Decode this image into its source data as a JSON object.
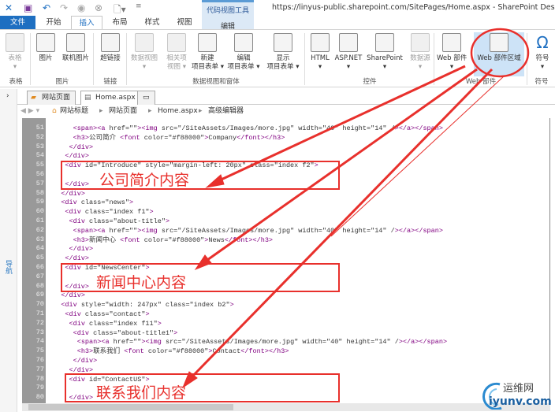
{
  "window": {
    "title": "https://linyus-public.sharepoint.com/SitePages/Home.aspx - SharePoint Designer",
    "context_tool": "代码视图工具",
    "context_tab": "编辑"
  },
  "tabs": [
    "文件",
    "开始",
    "插入",
    "布局",
    "样式",
    "视图"
  ],
  "ribbon": {
    "buttons": [
      {
        "label": "表格",
        "sub": "▾",
        "disabled": true
      },
      {
        "label": "图片"
      },
      {
        "label": "联机图片"
      },
      {
        "label": "超链接"
      },
      {
        "label": "数据视图",
        "sub": "▾",
        "disabled": true
      },
      {
        "label": "相关项",
        "sub": "视图 ▾",
        "disabled": true
      },
      {
        "label": "新建",
        "sub": "项目表单 ▾"
      },
      {
        "label": "编辑",
        "sub": "项目表单 ▾"
      },
      {
        "label": "显示",
        "sub": "项目表单 ▾"
      },
      {
        "label": "HTML",
        "sub": "▾"
      },
      {
        "label": "ASP.NET",
        "sub": "▾"
      },
      {
        "label": "SharePoint",
        "sub": "▾"
      },
      {
        "label": "数据源",
        "sub": "▾",
        "disabled": true
      },
      {
        "label": "Web 部件",
        "sub": "▾"
      },
      {
        "label": "Web 部件区域"
      },
      {
        "label": "符号",
        "sub": "▾"
      }
    ],
    "groups": [
      "表格",
      "图片",
      "链接",
      "数据视图和窗体",
      "控件",
      "Web 部件",
      "符号"
    ]
  },
  "doc_tabs": [
    "网站页面",
    "Home.aspx"
  ],
  "breadcrumb": [
    "网站标题",
    "网站页面",
    "Home.aspx",
    "高级编辑器"
  ],
  "left_panel": "导航",
  "code_lines": [
    {
      "n": 51,
      "t": "      <span><a href=\"\"><img src=\"/SiteAssets/Images/more.jpg\" width=\"40\" height=\"14\" /></a></span>"
    },
    {
      "n": 52,
      "t": "      <h3>公司简介 <font color=\"#f88000\">Company</font></h3>"
    },
    {
      "n": 53,
      "t": "     </div>"
    },
    {
      "n": 54,
      "t": "    </div>"
    },
    {
      "n": 55,
      "t": "    <div id=\"Introduce\" style=\"margin-left: 20px\" class=\"index f2\">"
    },
    {
      "n": 56,
      "t": ""
    },
    {
      "n": 57,
      "t": "    </div>"
    },
    {
      "n": 58,
      "t": "   </div>"
    },
    {
      "n": 59,
      "t": "   <div class=\"news\">"
    },
    {
      "n": 60,
      "t": "    <div class=\"index f1\">"
    },
    {
      "n": 61,
      "t": "     <div class=\"about-title\">"
    },
    {
      "n": 62,
      "t": "      <span><a href=\"\"><img src=\"/SiteAssets/Images/more.jpg\" width=\"40\" height=\"14\" /></a></span>"
    },
    {
      "n": 63,
      "t": "      <h3>新闻中心 <font color=\"#f88000\">News</font></h3>"
    },
    {
      "n": 64,
      "t": "     </div>"
    },
    {
      "n": 65,
      "t": "    </div>"
    },
    {
      "n": 66,
      "t": "    <div id=\"NewsCenter\">"
    },
    {
      "n": 67,
      "t": ""
    },
    {
      "n": 68,
      "t": "    </div>"
    },
    {
      "n": 69,
      "t": "   </div>"
    },
    {
      "n": 70,
      "t": "   <div style=\"width: 247px\" class=\"index b2\">"
    },
    {
      "n": 71,
      "t": "    <div class=\"contact\">"
    },
    {
      "n": 72,
      "t": "     <div class=\"index f11\">"
    },
    {
      "n": 73,
      "t": "      <div class=\"about-title1\">"
    },
    {
      "n": 74,
      "t": "       <span><a href=\"\"><img src=\"/SiteAssets/Images/more.jpg\" width=\"40\" height=\"14\" /></a></span>"
    },
    {
      "n": 75,
      "t": "       <h3>联系我们 <font color=\"#f88000\">Contact</font></h3>"
    },
    {
      "n": 76,
      "t": "      </div>"
    },
    {
      "n": 77,
      "t": "     </div>"
    },
    {
      "n": 78,
      "t": "     <div id=\"ContactUS\">"
    },
    {
      "n": 79,
      "t": ""
    },
    {
      "n": 80,
      "t": "     </div>"
    }
  ],
  "annotations": [
    "公司简介内容",
    "新闻中心内容",
    "联系我们内容"
  ],
  "watermark": {
    "cn": "运维网",
    "en": "iyunv.com"
  },
  "colors": {
    "accent": "#1e6fc1",
    "annotation": "#e8302c",
    "tag": "#800080",
    "attr": "#e02020",
    "value": "#1a1aa6"
  }
}
